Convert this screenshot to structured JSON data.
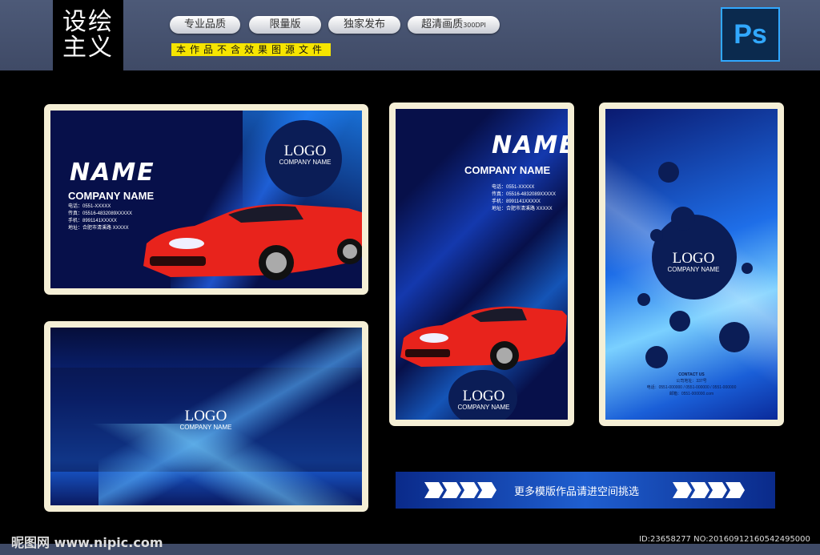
{
  "header": {
    "brand_line1": "设绘",
    "brand_line2": "主义",
    "pills": [
      "专业品质",
      "限量版",
      "独家发布",
      "超清画质"
    ],
    "dpi": "300DPI",
    "notice": "本作品不含效果图源文件",
    "ps_icon": "Ps"
  },
  "card1": {
    "name": "NAME",
    "company": "COMPANY NAME",
    "info": [
      "电话：0551-XXXXX",
      "传真：05516-4832089XXXXX",
      "手机：8991141XXXXX",
      "地址：合肥市清溪路 XXXXX"
    ],
    "logo": "LOGO",
    "logo_sub": "COMPANY NAME"
  },
  "card2": {
    "name": "NAME",
    "company": "COMPANY NAME",
    "info": [
      "电话：0551-XXXXX",
      "传真：05516-4832089XXXXX",
      "手机：8991141XXXXX",
      "地址：合肥市清溪路 XXXXX"
    ],
    "logo": "LOGO",
    "logo_sub": "COMPANY NAME"
  },
  "card3": {
    "logo": "LOGO",
    "logo_sub": "COMPANY NAME",
    "contact_title": "CONTACT US",
    "contact_lines": [
      "公司地址：337号",
      "电话：0551-000000 / 0551-000000 / 0551-000000",
      "邮箱：0551-000000.com"
    ]
  },
  "card4": {
    "logo": "LOGO",
    "logo_sub": "COMPANY NAME"
  },
  "banner": {
    "text": "更多模版作品请进空间挑选"
  },
  "footer": {
    "site": "昵图网 www.nipic.com",
    "id": "ID:23658277 NO:20160912160542495000"
  },
  "colors": {
    "accent": "#1f5fd0",
    "card_bg": "#07104a",
    "frame": "#f5efd6",
    "car": "#e8231c",
    "notice_bg": "#f6e500"
  }
}
